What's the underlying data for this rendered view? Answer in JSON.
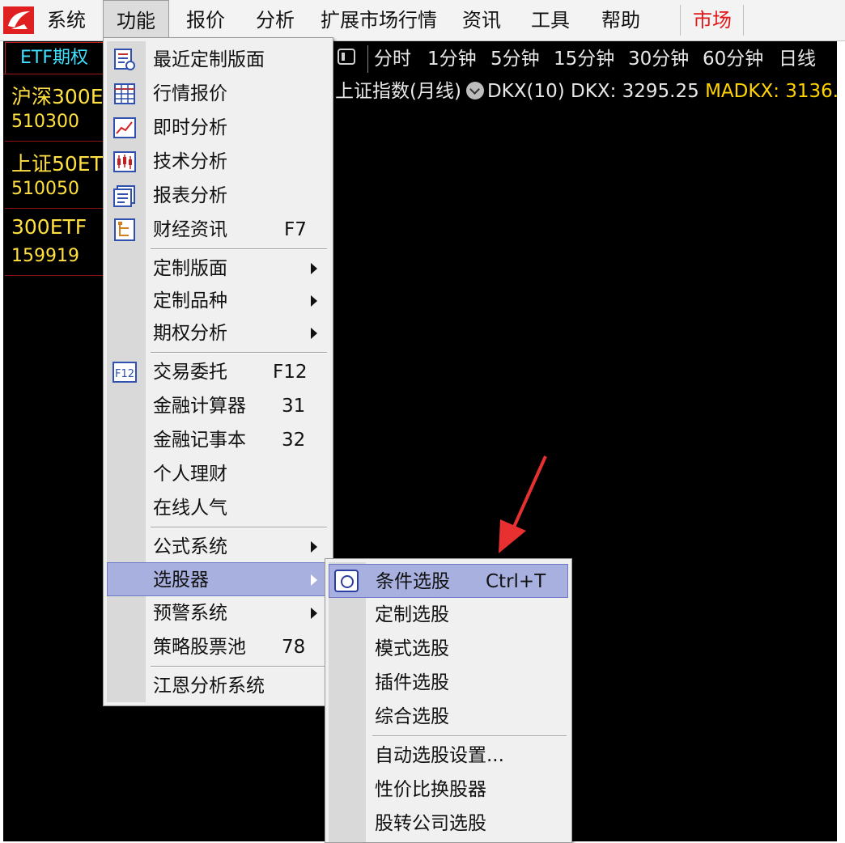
{
  "menubar": {
    "items": [
      "系统",
      "功能",
      "报价",
      "分析",
      "扩展市场行情",
      "资讯",
      "工具",
      "帮助"
    ],
    "market": "市场",
    "active": "功能"
  },
  "left_panel": {
    "tab": "ETF期权",
    "items": [
      {
        "name": "沪深300E",
        "code": "510300"
      },
      {
        "name": "上证50ET",
        "code": "510050"
      },
      {
        "name": "300ETF",
        "code": "159919"
      }
    ]
  },
  "periods": [
    "分时",
    "1分钟",
    "5分钟",
    "15分钟",
    "30分钟",
    "60分钟",
    "日线"
  ],
  "index_line": {
    "title": "上证指数(月线)",
    "indicator": "DKX(10)",
    "dkx": "DKX: 3295.25",
    "madkx": "MADKX: 3136."
  },
  "func_menu": {
    "items": [
      {
        "label": "最近定制版面",
        "icon": "recent-layout-icon"
      },
      {
        "label": "行情报价",
        "icon": "quote-table-icon"
      },
      {
        "label": "即时分析",
        "icon": "realtime-chart-icon"
      },
      {
        "label": "技术分析",
        "icon": "candlestick-icon"
      },
      {
        "label": "报表分析",
        "icon": "report-icon"
      },
      {
        "label": "财经资讯",
        "shortcut": "F7",
        "icon": "news-tree-icon"
      },
      {
        "label": "定制版面",
        "submenu": true
      },
      {
        "label": "定制品种",
        "submenu": true
      },
      {
        "label": "期权分析",
        "submenu": true
      },
      {
        "label": "交易委托",
        "shortcut": "F12",
        "icon": "f12-icon"
      },
      {
        "label": "金融计算器",
        "shortcut": "31"
      },
      {
        "label": "金融记事本",
        "shortcut": "32"
      },
      {
        "label": "个人理财"
      },
      {
        "label": "在线人气"
      },
      {
        "label": "公式系统",
        "submenu": true
      },
      {
        "label": "选股器",
        "submenu": true,
        "highlighted": true
      },
      {
        "label": "预警系统",
        "submenu": true
      },
      {
        "label": "策略股票池",
        "shortcut": "78"
      },
      {
        "label": "江恩分析系统"
      }
    ],
    "f12_icon_text": "F12"
  },
  "sub_menu": {
    "items": [
      {
        "label": "条件选股",
        "shortcut": "Ctrl+T",
        "highlighted": true,
        "icon": "condition-select-icon"
      },
      {
        "label": "定制选股"
      },
      {
        "label": "模式选股"
      },
      {
        "label": "插件选股"
      },
      {
        "label": "综合选股"
      },
      {
        "label": "自动选股设置..."
      },
      {
        "label": "性价比换股器"
      },
      {
        "label": "股转公司选股"
      }
    ]
  },
  "colors": {
    "workspace_bg": "#000000",
    "etf_text": "#ffe040",
    "tab_text": "#40e0ff",
    "market_red": "#e01818",
    "highlight": "#a8b0e0",
    "madkx": "#ffd400",
    "annotation_arrow": "#e83030"
  }
}
